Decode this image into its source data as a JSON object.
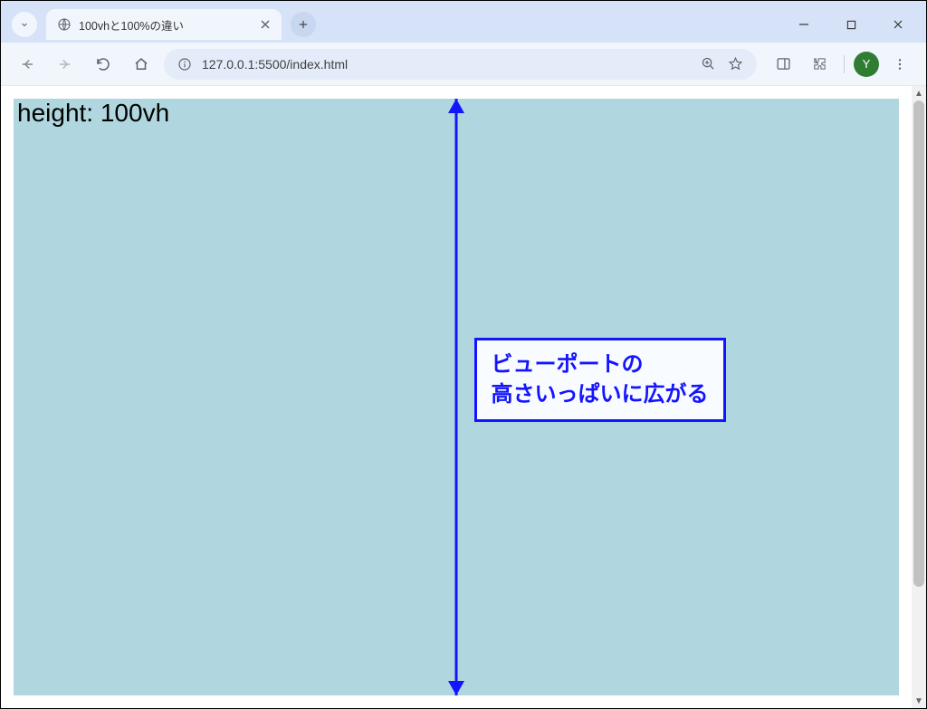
{
  "window": {
    "minimize_label": "—",
    "maximize_label": "□",
    "close_label": "✕"
  },
  "tab": {
    "title": "100vhと100%の違い"
  },
  "address_bar": {
    "url": "127.0.0.1:5500/index.html"
  },
  "avatar": {
    "initial": "Y"
  },
  "page": {
    "demo_label": "height: 100vh",
    "annotation": "ビューポートの\n高さいっぱいに広がる"
  }
}
